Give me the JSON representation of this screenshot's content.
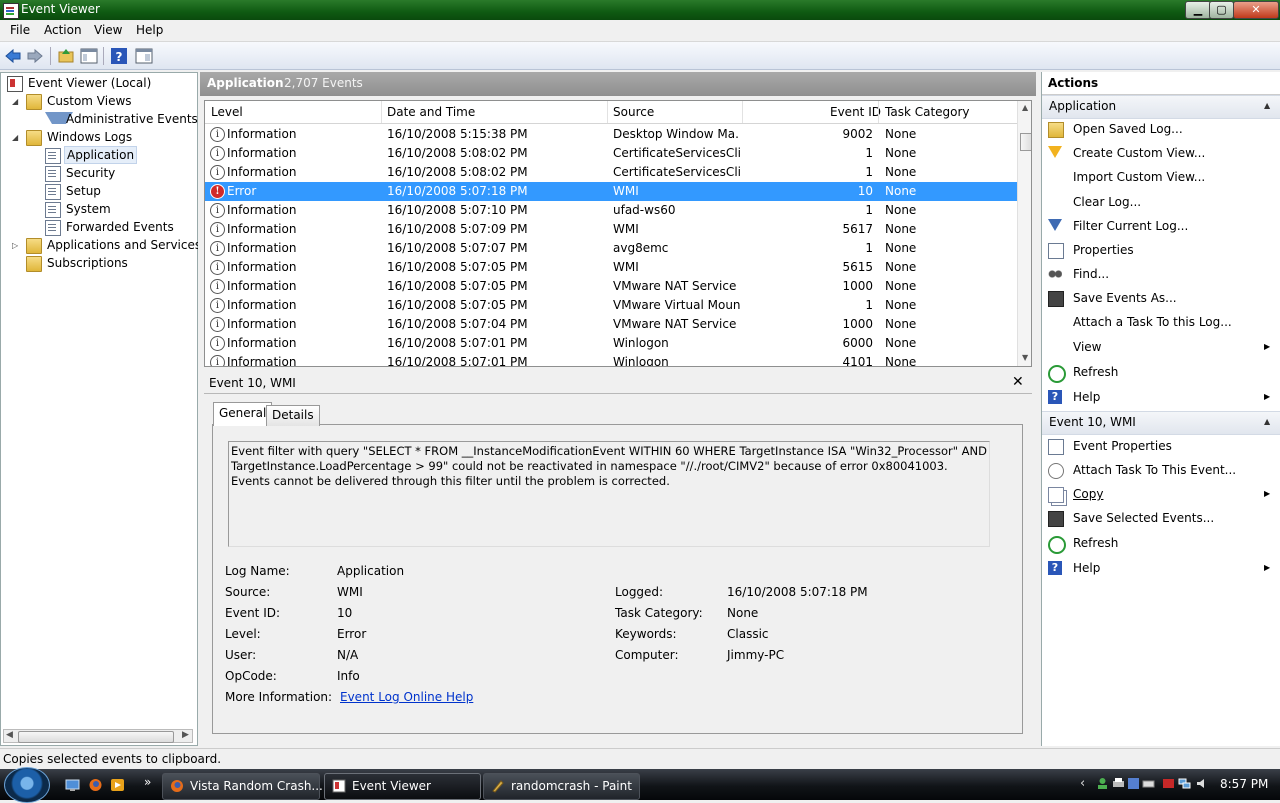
{
  "window": {
    "title": "Event Viewer"
  },
  "window_buttons": {
    "minimize": "▁",
    "maximize": "▢",
    "close": "✕"
  },
  "menu": [
    "File",
    "Action",
    "View",
    "Help"
  ],
  "tree": {
    "root": "Event Viewer (Local)",
    "custom_views": "Custom Views",
    "administrative_events": "Administrative Events",
    "windows_logs": "Windows Logs",
    "application": "Application",
    "security": "Security",
    "setup": "Setup",
    "system": "System",
    "forwarded_events": "Forwarded Events",
    "apps_services": "Applications and Services Lo",
    "subscriptions": "Subscriptions"
  },
  "log_header": {
    "name": "Application",
    "count": "2,707 Events"
  },
  "grid": {
    "columns": [
      "Level",
      "Date and Time",
      "Source",
      "Event ID",
      "Task Category"
    ],
    "rows": [
      {
        "level": "Information",
        "date": "16/10/2008 5:15:38 PM",
        "source": "Desktop Window Ma...",
        "id": "9002",
        "cat": "None"
      },
      {
        "level": "Information",
        "date": "16/10/2008 5:08:02 PM",
        "source": "CertificateServicesCli...",
        "id": "1",
        "cat": "None"
      },
      {
        "level": "Information",
        "date": "16/10/2008 5:08:02 PM",
        "source": "CertificateServicesCli...",
        "id": "1",
        "cat": "None"
      },
      {
        "level": "Error",
        "date": "16/10/2008 5:07:18 PM",
        "source": "WMI",
        "id": "10",
        "cat": "None"
      },
      {
        "level": "Information",
        "date": "16/10/2008 5:07:10 PM",
        "source": "ufad-ws60",
        "id": "1",
        "cat": "None"
      },
      {
        "level": "Information",
        "date": "16/10/2008 5:07:09 PM",
        "source": "WMI",
        "id": "5617",
        "cat": "None"
      },
      {
        "level": "Information",
        "date": "16/10/2008 5:07:07 PM",
        "source": "avg8emc",
        "id": "1",
        "cat": "None"
      },
      {
        "level": "Information",
        "date": "16/10/2008 5:07:05 PM",
        "source": "WMI",
        "id": "5615",
        "cat": "None"
      },
      {
        "level": "Information",
        "date": "16/10/2008 5:07:05 PM",
        "source": "VMware NAT Service",
        "id": "1000",
        "cat": "None"
      },
      {
        "level": "Information",
        "date": "16/10/2008 5:07:05 PM",
        "source": "VMware Virtual Moun...",
        "id": "1",
        "cat": "None"
      },
      {
        "level": "Information",
        "date": "16/10/2008 5:07:04 PM",
        "source": "VMware NAT Service",
        "id": "1000",
        "cat": "None"
      },
      {
        "level": "Information",
        "date": "16/10/2008 5:07:01 PM",
        "source": "Winlogon",
        "id": "6000",
        "cat": "None"
      },
      {
        "level": "Information",
        "date": "16/10/2008 5:07:01 PM",
        "source": "Winlogon",
        "id": "4101",
        "cat": "None"
      }
    ],
    "selected_index": 3
  },
  "detail": {
    "title": "Event 10, WMI",
    "tabs": [
      "General",
      "Details"
    ],
    "description": "Event filter with query \"SELECT * FROM __InstanceModificationEvent WITHIN 60 WHERE TargetInstance ISA \"Win32_Processor\" AND TargetInstance.LoadPercentage > 99\" could not be reactivated in namespace \"//./root/CIMV2\" because of error 0x80041003. Events cannot be delivered through this filter until the problem is corrected.",
    "labels": {
      "log_name": "Log Name:",
      "source": "Source:",
      "event_id": "Event ID:",
      "level": "Level:",
      "user": "User:",
      "opcode": "OpCode:",
      "more_info": "More Information:",
      "logged": "Logged:",
      "task_category": "Task Category:",
      "keywords": "Keywords:",
      "computer": "Computer:"
    },
    "values": {
      "log_name": "Application",
      "source": "WMI",
      "event_id": "10",
      "level": "Error",
      "user": "N/A",
      "opcode": "Info",
      "more_info": "Event Log Online Help",
      "logged": "16/10/2008 5:07:18 PM",
      "task_category": "None",
      "keywords": "Classic",
      "computer": "Jimmy-PC"
    }
  },
  "actions": {
    "title": "Actions",
    "section1": "Application",
    "items1": [
      "Open Saved Log...",
      "Create Custom View...",
      "Import Custom View...",
      "Clear Log...",
      "Filter Current Log...",
      "Properties",
      "Find...",
      "Save Events As...",
      "Attach a Task To this Log...",
      "View",
      "Refresh",
      "Help"
    ],
    "section2": "Event 10, WMI",
    "items2": [
      "Event Properties",
      "Attach Task To This Event...",
      "Copy",
      "Save Selected Events...",
      "Refresh",
      "Help"
    ]
  },
  "status": "Copies selected events to clipboard.",
  "taskbar": {
    "tasks": [
      "Vista Random Crash...",
      "Event Viewer",
      "randomcrash - Paint"
    ],
    "clock": "8:57 PM",
    "ql_more": "»"
  },
  "glyphs": {
    "info": "i",
    "error": "!",
    "close": "✕",
    "submenu": "▶",
    "collapse": "▲",
    "tri_open": "◢",
    "tri_closed": "▷",
    "up": "▲",
    "down": "▼",
    "left": "◀",
    "right": "▶",
    "grip": "|||",
    "tray_arrow": "‹",
    "help": "?"
  }
}
